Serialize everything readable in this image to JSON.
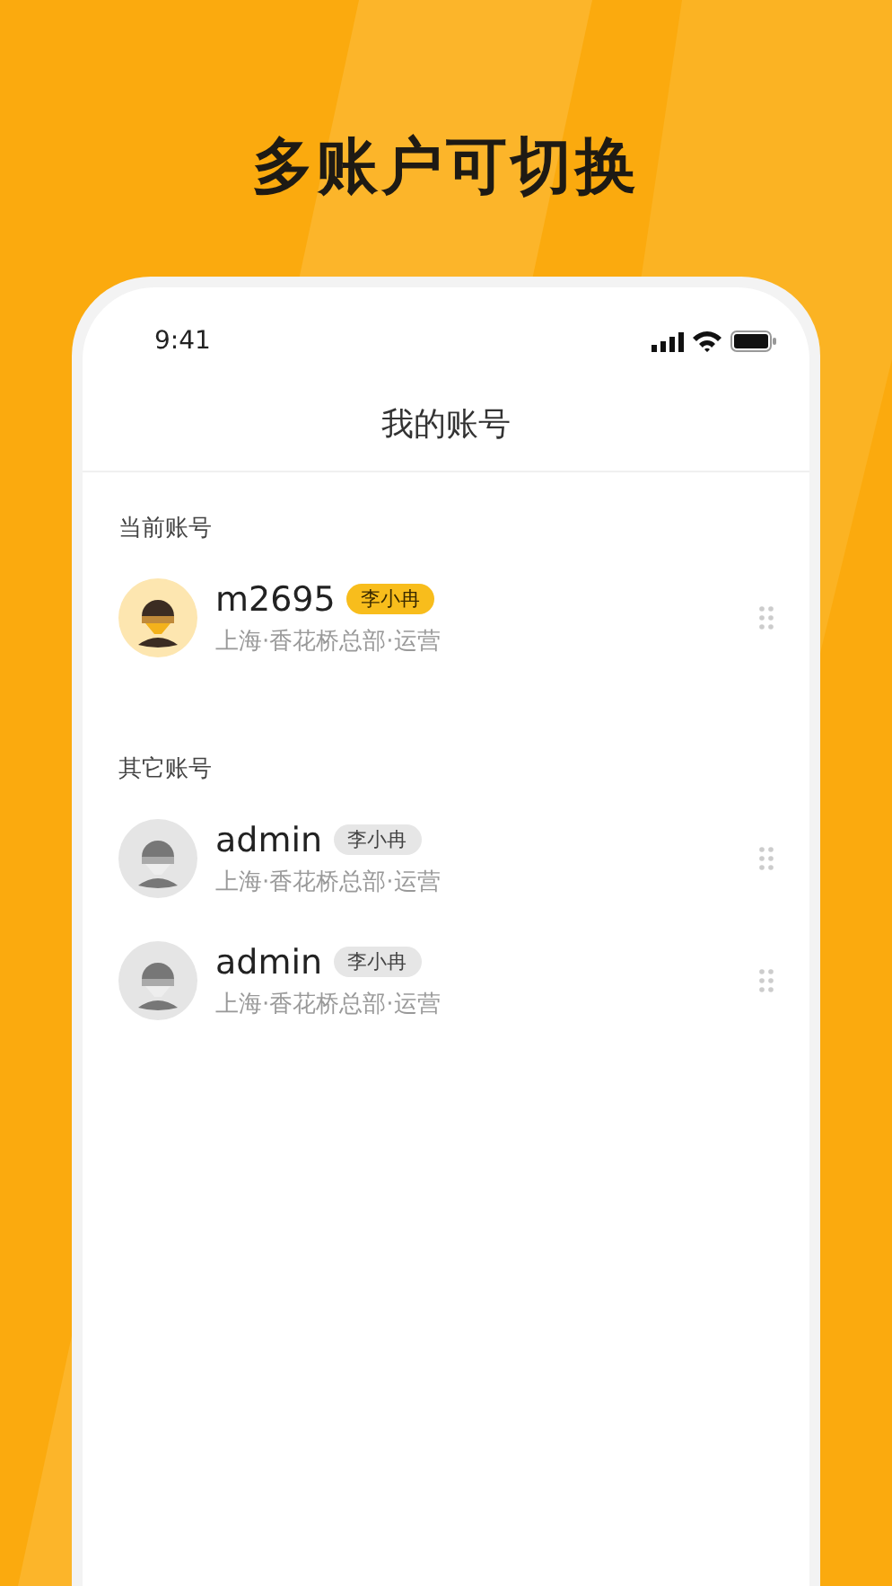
{
  "headline": "多账户可切换",
  "status_bar": {
    "time": "9:41"
  },
  "nav": {
    "title": "我的账号"
  },
  "sections": [
    {
      "title": "当前账号",
      "accounts": [
        {
          "name": "m2695",
          "tag": "李小冉",
          "detail": "上海·香花桥总部·运营",
          "selected": true
        }
      ]
    },
    {
      "title": "其它账号",
      "accounts": [
        {
          "name": "admin",
          "tag": "李小冉",
          "detail": "上海·香花桥总部·运营",
          "selected": false
        },
        {
          "name": "admin",
          "tag": "李小冉",
          "detail": "上海·香花桥总部·运营",
          "selected": false
        }
      ]
    }
  ]
}
